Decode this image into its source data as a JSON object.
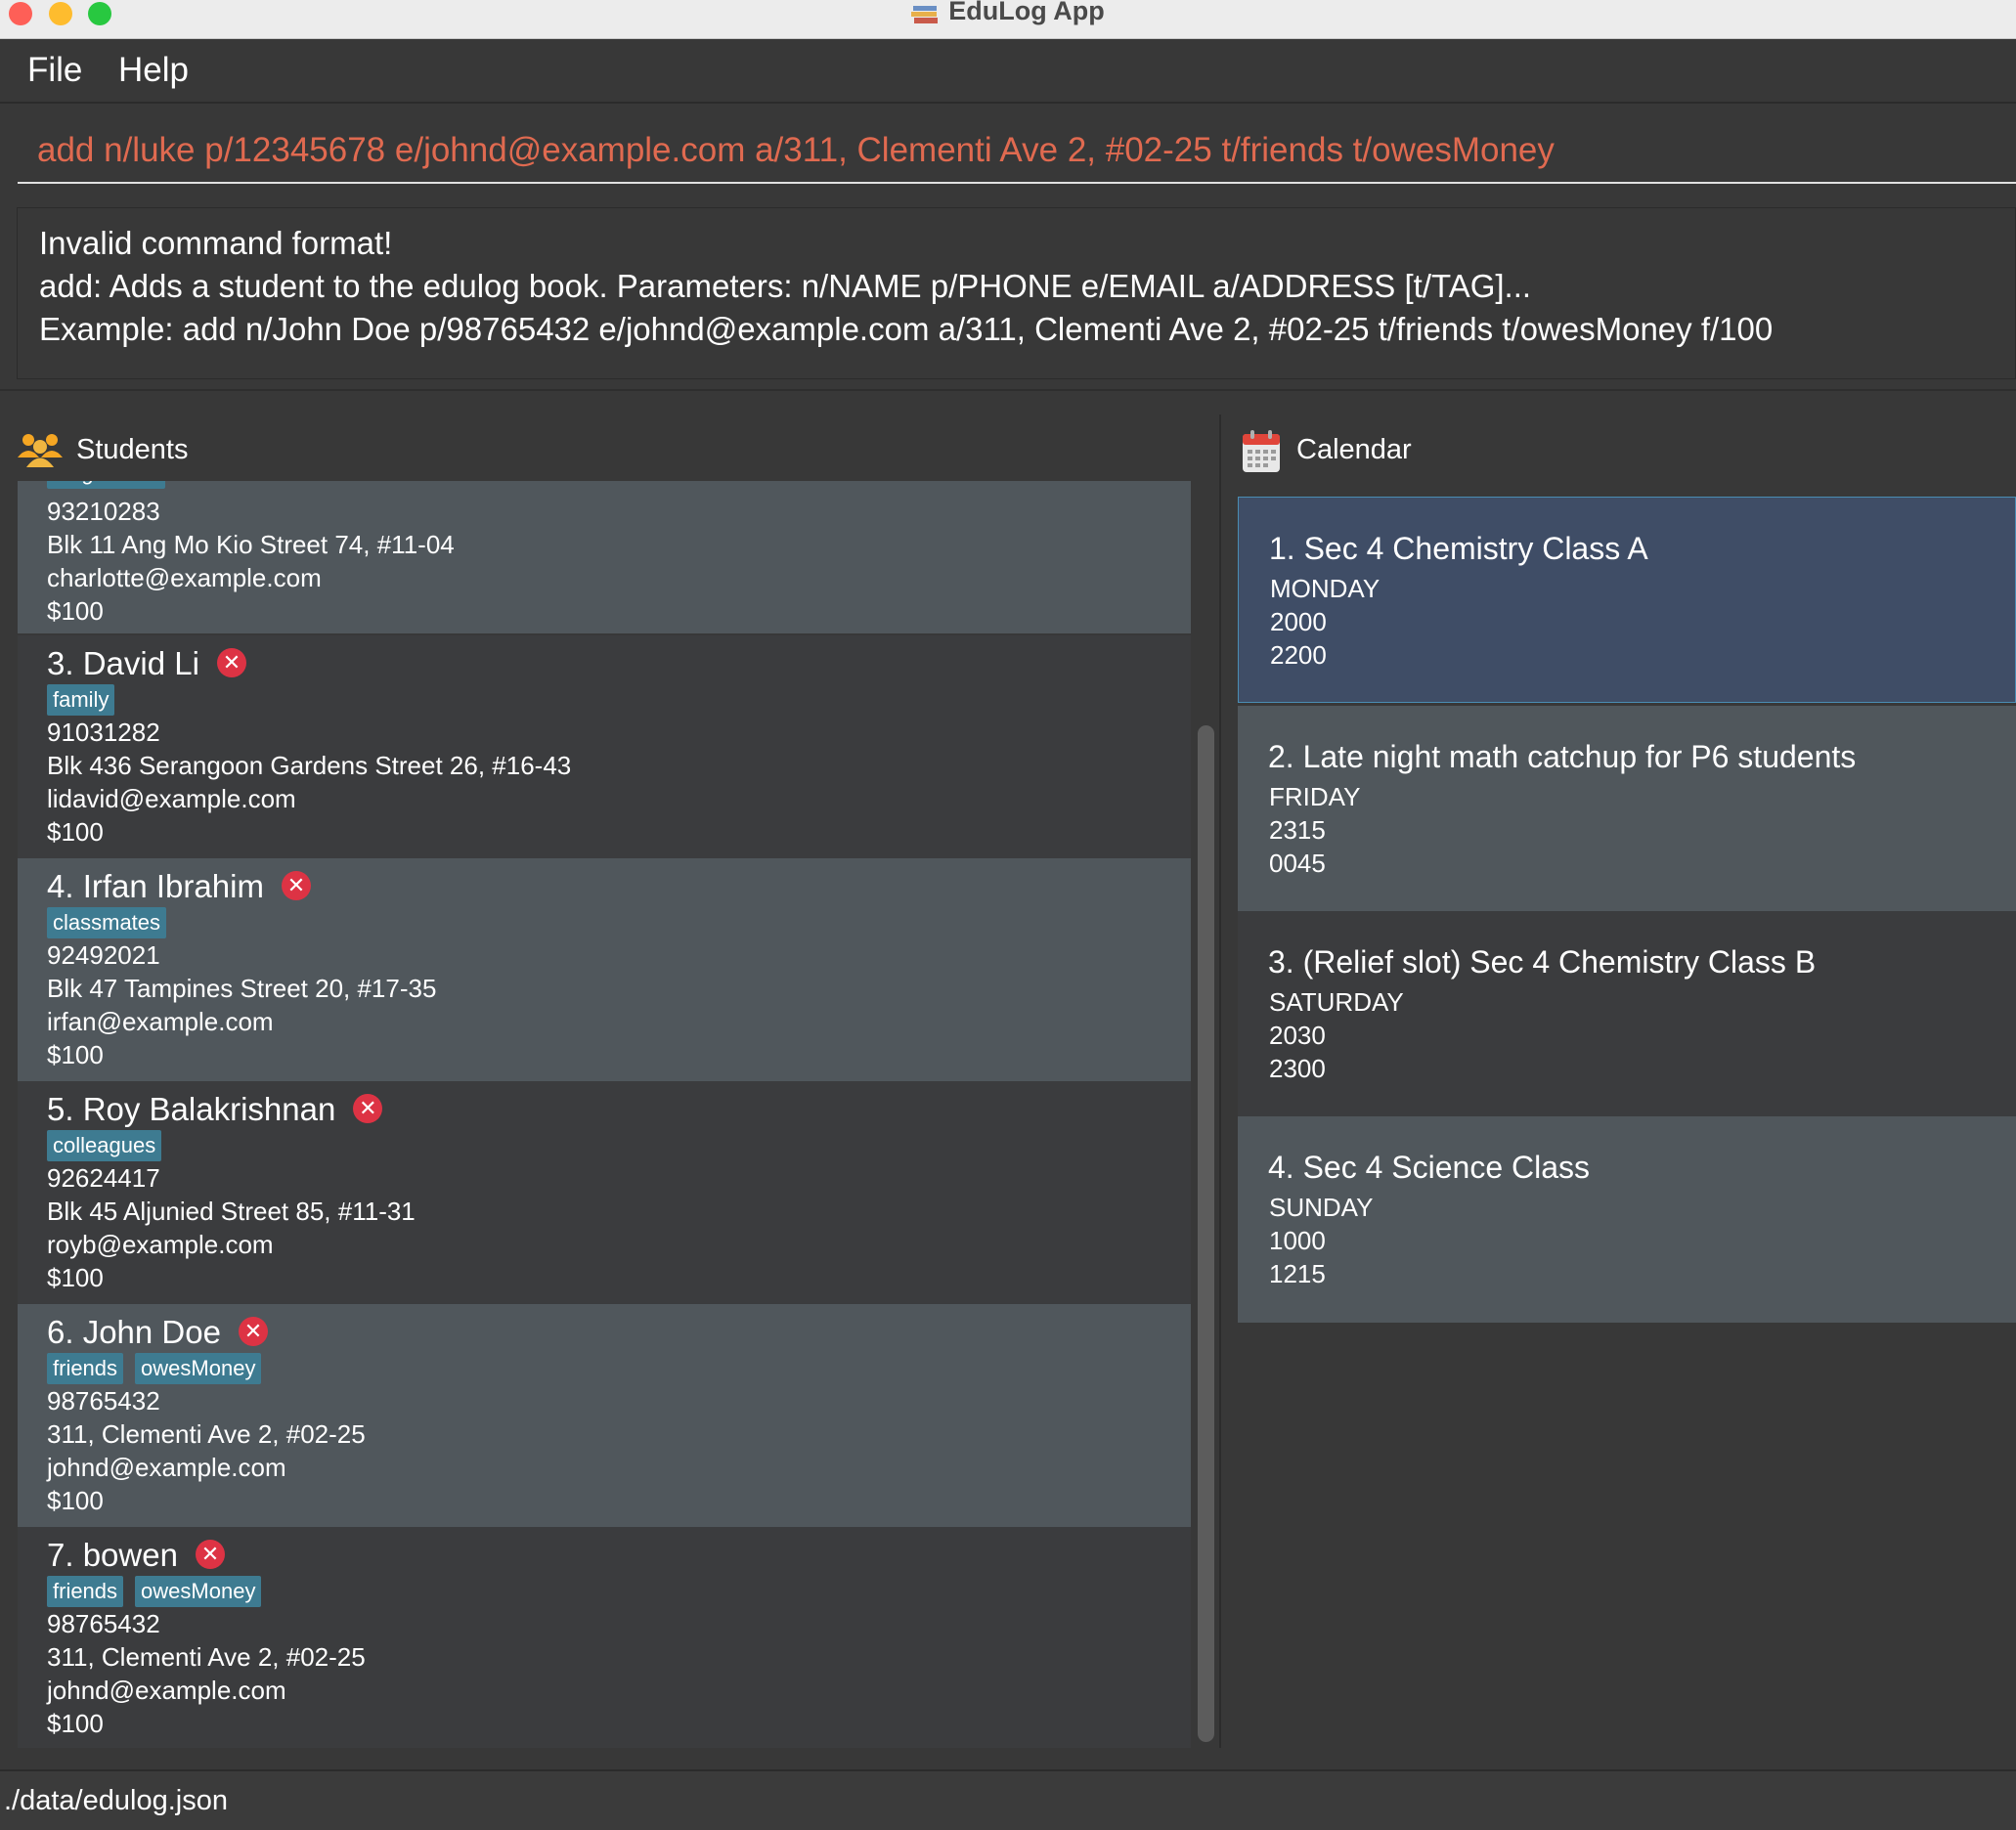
{
  "window": {
    "title": "EduLog App"
  },
  "menu": {
    "file": "File",
    "help": "Help"
  },
  "command": {
    "value": "add n/luke p/12345678 e/johnd@example.com a/311, Clementi Ave 2, #02-25 t/friends t/owesMoney"
  },
  "result": {
    "lines": [
      "Invalid command format!",
      "add: Adds a student to the edulog book. Parameters: n/NAME p/PHONE e/EMAIL a/ADDRESS [t/TAG]...",
      "Example: add n/John Doe p/98765432 e/johnd@example.com a/311, Clementi Ave 2, #02-25 t/friends t/owesMoney f/100"
    ]
  },
  "students_panel": {
    "title": "Students",
    "partial": {
      "tag": "neighbours",
      "phone": "93210283",
      "address": "Blk 11 Ang Mo Kio Street 74, #11-04",
      "email": "charlotte@example.com",
      "fee": "$100"
    },
    "items": [
      {
        "name": "3. David Li",
        "tags": [
          "family"
        ],
        "phone": "91031282",
        "address": "Blk 436 Serangoon Gardens Street 26, #16-43",
        "email": "lidavid@example.com",
        "fee": "$100"
      },
      {
        "name": "4. Irfan Ibrahim",
        "tags": [
          "classmates"
        ],
        "phone": "92492021",
        "address": "Blk 47 Tampines Street 20, #17-35",
        "email": "irfan@example.com",
        "fee": "$100"
      },
      {
        "name": "5. Roy Balakrishnan",
        "tags": [
          "colleagues"
        ],
        "phone": "92624417",
        "address": "Blk 45 Aljunied Street 85, #11-31",
        "email": "royb@example.com",
        "fee": "$100"
      },
      {
        "name": "6. John Doe",
        "tags": [
          "friends",
          "owesMoney"
        ],
        "phone": "98765432",
        "address": "311, Clementi Ave 2, #02-25",
        "email": "johnd@example.com",
        "fee": "$100"
      },
      {
        "name": "7. bowen",
        "tags": [
          "friends",
          "owesMoney"
        ],
        "phone": "98765432",
        "address": "311, Clementi Ave 2, #02-25",
        "email": "johnd@example.com",
        "fee": "$100"
      }
    ]
  },
  "calendar_panel": {
    "title": "Calendar",
    "items": [
      {
        "title": "1. Sec 4 Chemistry Class A",
        "day": "MONDAY",
        "start": "2000",
        "end": "2200"
      },
      {
        "title": "2. Late night math catchup for P6 students",
        "day": "FRIDAY",
        "start": "2315",
        "end": "0045"
      },
      {
        "title": "3. (Relief slot) Sec 4 Chemistry Class B",
        "day": "SATURDAY",
        "start": "2030",
        "end": "2300"
      },
      {
        "title": "4. Sec 4 Science Class",
        "day": "SUNDAY",
        "start": "1000",
        "end": "1215"
      }
    ]
  },
  "status": {
    "path": "./data/edulog.json"
  },
  "colors": {
    "accent_text": "#e06a50",
    "tag": "#3e7b91",
    "delete": "#dd3344",
    "selected": "#3f4d66"
  }
}
